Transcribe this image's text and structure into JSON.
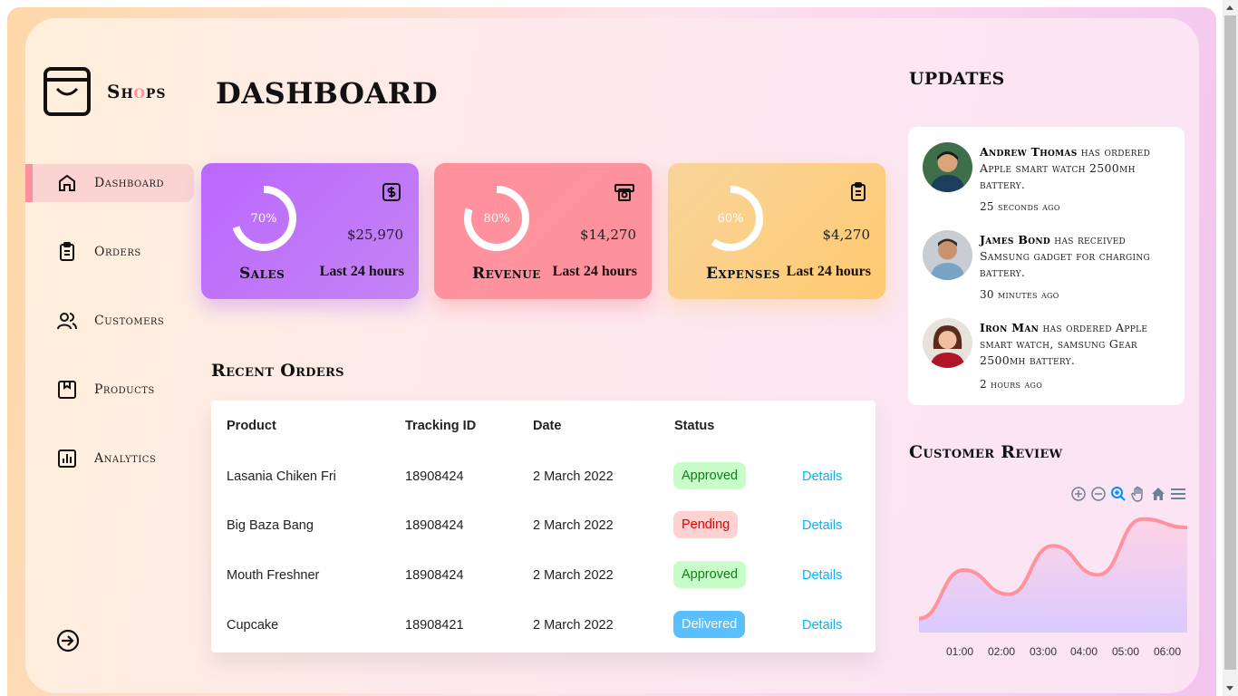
{
  "logo": {
    "text_before": "Sh",
    "text_accent": "o",
    "text_after": "ps"
  },
  "page_title": "DASHBOARD",
  "sidebar": {
    "items": [
      {
        "label": "Dashboard",
        "icon": "home-icon",
        "active": true
      },
      {
        "label": "Orders",
        "icon": "clipboard-icon"
      },
      {
        "label": "Customers",
        "icon": "users-icon"
      },
      {
        "label": "Products",
        "icon": "package-icon"
      },
      {
        "label": "Analytics",
        "icon": "bar-chart-icon"
      }
    ],
    "logout_icon": "sign-out-icon"
  },
  "cards": [
    {
      "name": "Sales",
      "percent": "70%",
      "progress": 0.7,
      "value": "$25,970",
      "period": "Last 24 hours",
      "icon": "dollar-icon"
    },
    {
      "name": "Revenue",
      "percent": "80%",
      "progress": 0.8,
      "value": "$14,270",
      "period": "Last 24 hours",
      "icon": "money-icon"
    },
    {
      "name": "Expenses",
      "percent": "60%",
      "progress": 0.6,
      "value": "$4,270",
      "period": "Last 24 hours",
      "icon": "clipboard-icon"
    }
  ],
  "recent_orders": {
    "title": "Recent Orders",
    "headers": {
      "product": "Product",
      "tracking": "Tracking ID",
      "date": "Date",
      "status": "Status"
    },
    "rows": [
      {
        "product": "Lasania Chiken Fri",
        "tracking": "18908424",
        "date": "2 March 2022",
        "status": "Approved",
        "details": "Details"
      },
      {
        "product": "Big Baza Bang",
        "tracking": "18908424",
        "date": "2 March 2022",
        "status": "Pending",
        "details": "Details"
      },
      {
        "product": "Mouth Freshner",
        "tracking": "18908424",
        "date": "2 March 2022",
        "status": "Approved",
        "details": "Details"
      },
      {
        "product": "Cupcake",
        "tracking": "18908421",
        "date": "2 March 2022",
        "status": "Delivered",
        "details": "Details"
      }
    ]
  },
  "updates": {
    "title": "UPDATES",
    "items": [
      {
        "name": "Andrew Thomas",
        "text": " has ordered Apple smart watch 2500mh battery.",
        "time": "25 seconds ago"
      },
      {
        "name": "James Bond",
        "text": " has received Samsung gadget for charging battery.",
        "time": "30 minutes ago"
      },
      {
        "name": "Iron Man",
        "text": " has ordered Apple smart watch, samsung Gear 2500mh battery.",
        "time": "2 hours ago"
      }
    ]
  },
  "customer_review": {
    "title": "Customer Review",
    "toolbar": [
      "zoom-in-icon",
      "zoom-out-icon",
      "search-zoom-icon",
      "pan-hand-icon",
      "home-reset-icon",
      "menu-icon"
    ]
  },
  "colors": {
    "accent": "#ff8f9c",
    "sales": "#bb67ff",
    "revenue": "#ff919d",
    "expenses": "#ffca71",
    "link": "#00b5ff"
  },
  "chart_data": {
    "type": "area",
    "x": [
      "01:00",
      "02:00",
      "03:00",
      "04:00",
      "05:00",
      "06:00"
    ],
    "series": [
      {
        "values": [
          10,
          50,
          30,
          70,
          46,
          92,
          85
        ]
      }
    ],
    "y_range": [
      0,
      100
    ],
    "grid": false,
    "note_x": "tick labels 01:00–06:00"
  }
}
